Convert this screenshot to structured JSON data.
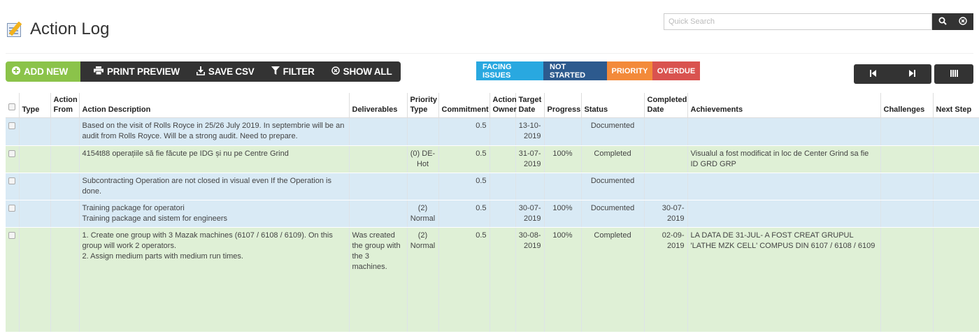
{
  "page": {
    "title": "Action Log"
  },
  "search": {
    "placeholder": "Quick Search"
  },
  "toolbar": {
    "add_new": "ADD NEW",
    "print_preview": "PRINT PREVIEW",
    "save_csv": "SAVE CSV",
    "filter": "FILTER",
    "show_all": "SHOW ALL"
  },
  "legend": {
    "facing_issues": "FACING ISSUES",
    "not_started": "NOT STARTED",
    "priority": "PRIORITY",
    "overdue": "OVERDUE",
    "colors": {
      "facing_issues": "#29a8e0",
      "not_started": "#2d5a8e",
      "priority": "#f38a3a",
      "overdue": "#d9534f"
    }
  },
  "icons": {
    "add": "plus-circle-icon",
    "print": "printer-icon",
    "save": "download-icon",
    "filter": "filter-icon",
    "show_all": "close-circle-icon",
    "search": "search-icon",
    "clear": "clear-icon",
    "first": "first-page-icon",
    "last": "last-page-icon",
    "columns": "columns-icon"
  },
  "table": {
    "headers": {
      "type": "Type",
      "action_from": "Action From",
      "description": "Action Description",
      "deliverables": "Deliverables",
      "priority_type": "Priority Type",
      "commitment": "Commitment",
      "action_owner": "Action Owner",
      "target_date": "Target Date",
      "progress": "Progress",
      "status": "Status",
      "completed_date": "Completed Date",
      "achievements": "Achievements",
      "challenges": "Challenges",
      "next_step": "Next Step"
    },
    "rows": [
      {
        "type": "",
        "action_from": "",
        "description": "Based on the visit of Rolls Royce in 25/26 July 2019. In septembrie will be an audit from Rolls Royce. Will be a strong audit. Need to prepare.",
        "deliverables": "",
        "priority_type": "",
        "commitment": "0.5",
        "action_owner": "",
        "target_date": "13-10-2019",
        "progress": "",
        "status": "Documented",
        "completed_date": "",
        "achievements": "",
        "challenges": "",
        "next_step": ""
      },
      {
        "type": "",
        "action_from": "",
        "description": "4154t88 operațiile să fie făcute pe IDG și nu pe Centre Grind",
        "deliverables": "",
        "priority_type": "(0) DE-Hot",
        "commitment": "0.5",
        "action_owner": "",
        "target_date": "31-07-2019",
        "progress": "100%",
        "status": "Completed",
        "completed_date": "",
        "achievements": "Visualul a fost modificat in loc de Center Grind sa fie ID GRD GRP",
        "challenges": "",
        "next_step": ""
      },
      {
        "type": "",
        "action_from": "",
        "description": "Subcontracting Operation are not closed in visual even If the Operation is done.",
        "deliverables": "",
        "priority_type": "",
        "commitment": "0.5",
        "action_owner": "",
        "target_date": "",
        "progress": "",
        "status": "Documented",
        "completed_date": "",
        "achievements": "",
        "challenges": "",
        "next_step": ""
      },
      {
        "type": "",
        "action_from": "",
        "description": "Training package for operatori\nTraining package and sistem for engineers",
        "deliverables": "",
        "priority_type": "(2) Normal",
        "commitment": "0.5",
        "action_owner": "",
        "target_date": "30-07-2019",
        "progress": "100%",
        "status": "Documented",
        "completed_date": "30-07-2019",
        "achievements": "",
        "challenges": "",
        "next_step": ""
      },
      {
        "type": "",
        "action_from": "",
        "description": "1. Create one group with 3 Mazak machines (6107 / 6108 / 6109). On this group will work 2 operators.\n2. Assign medium parts with medium run times.",
        "deliverables": "Was created the group with the 3 machines.",
        "priority_type": "(2) Normal",
        "commitment": "0.5",
        "action_owner": "",
        "target_date": "30-08-2019",
        "progress": "100%",
        "status": "Completed",
        "completed_date": "02-09-2019",
        "achievements": "LA DATA DE 31-JUL- A FOST CREAT GRUPUL 'LATHE MZK CELL' COMPUS DIN 6107 / 6108 / 6109",
        "challenges": "",
        "next_step": ""
      }
    ]
  }
}
